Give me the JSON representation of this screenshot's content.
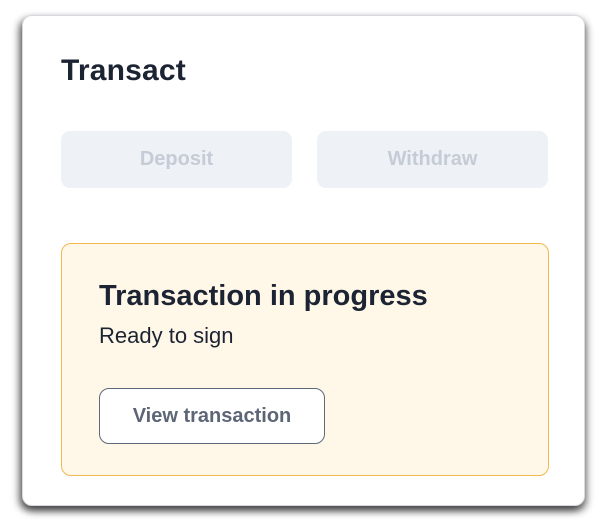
{
  "card": {
    "title": "Transact"
  },
  "actions": {
    "deposit_label": "Deposit",
    "withdraw_label": "Withdraw"
  },
  "progress": {
    "title": "Transaction in progress",
    "status": "Ready to sign",
    "view_button_label": "View transaction"
  },
  "colors": {
    "panel_background": "#fff8e8",
    "panel_border": "#f2b84b",
    "disabled_button_background": "#eef1f5",
    "disabled_button_text": "#c5ccd6",
    "text_primary": "#1c2333"
  }
}
